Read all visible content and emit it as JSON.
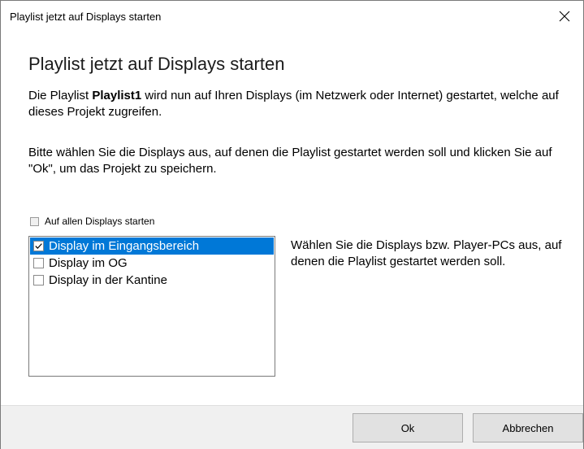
{
  "window": {
    "title": "Playlist jetzt auf Displays starten"
  },
  "main": {
    "heading": "Playlist jetzt auf Displays starten",
    "desc1_prefix": "Die Playlist ",
    "desc1_name": "Playlist1",
    "desc1_suffix": " wird nun auf Ihren Displays (im Netzwerk oder Internet) gestartet, welche auf dieses Projekt zugreifen.",
    "desc2": "Bitte wählen Sie die Displays aus, auf denen die Playlist gestartet werden soll und klicken Sie auf \"Ok\", um das Projekt zu speichern.",
    "all_checkbox_label": "Auf allen Displays starten",
    "all_checkbox_checked": false,
    "displays": [
      {
        "label": "Display im Eingangsbereich",
        "checked": true,
        "selected": true
      },
      {
        "label": "Display im OG",
        "checked": false,
        "selected": false
      },
      {
        "label": "Display in der Kantine",
        "checked": false,
        "selected": false
      }
    ],
    "help_text": "Wählen Sie die Displays bzw. Player-PCs aus, auf denen die Playlist gestartet werden soll."
  },
  "footer": {
    "ok_label": "Ok",
    "cancel_label": "Abbrechen"
  },
  "colors": {
    "selection": "#0078d7",
    "footer_bg": "#f0f0f0"
  },
  "icons": {
    "close": "close-icon",
    "check": "check-icon"
  }
}
